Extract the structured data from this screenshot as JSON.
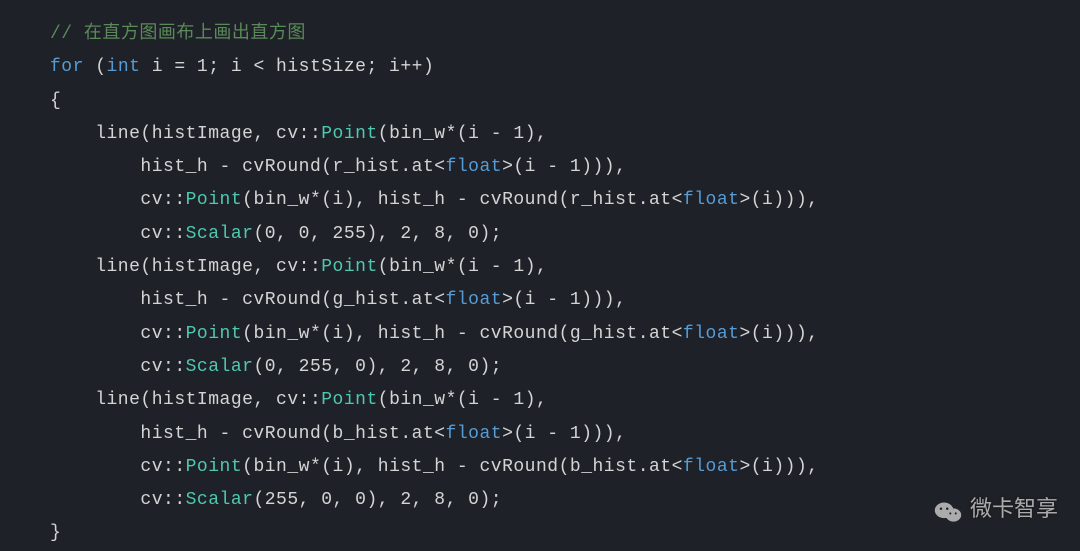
{
  "code": {
    "comment": "// 在直方图画布上画出直方图",
    "for_kw": "for",
    "int_type": "int",
    "for_decl": " i = 1; i < histSize; i++)",
    "brace_open": "{",
    "brace_close": "}",
    "line_prefix": "    line(histImage, cv::",
    "point_class": "Point",
    "scalar_class": "Scalar",
    "float_type": "float",
    "bin_i1_open": "(bin_w*(i - 1),",
    "round_r_a": "        hist_h - cvRound(r_hist.at<",
    "round_r_b": ">(i - 1))),",
    "cv_point2": "        cv::",
    "bin_i_open": "(bin_w*(i), hist_h - cvRound(r_hist.at<",
    "r_tail": ">(i))),",
    "cv_scalar_pre": "        cv::",
    "scalar_r_args": "(0, 0, 255), 2, 8, 0);",
    "round_g_a": "        hist_h - cvRound(g_hist.at<",
    "bin_i_g": "(bin_w*(i), hist_h - cvRound(g_hist.at<",
    "g_tail": ">(i))),",
    "scalar_g_args": "(0, 255, 0), 2, 8, 0);",
    "round_b_a": "        hist_h - cvRound(b_hist.at<",
    "bin_i_b": "(bin_w*(i), hist_h - cvRound(b_hist.at<",
    "b_tail": ">(i))),",
    "scalar_b_args": "(255, 0, 0), 2, 8, 0);"
  },
  "watermark": {
    "text": "微卡智享"
  }
}
